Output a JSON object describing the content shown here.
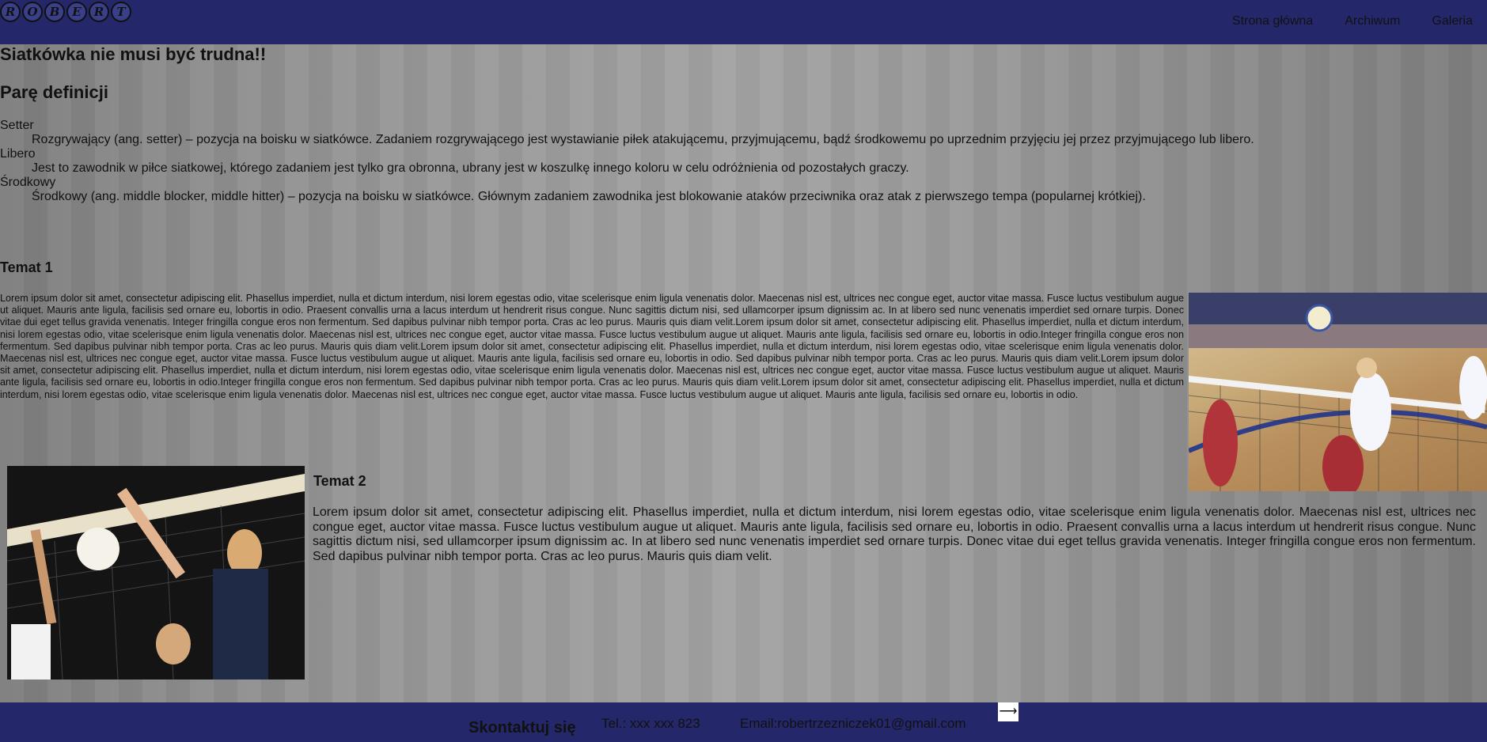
{
  "header": {
    "logo_letters": [
      "R",
      "O",
      "B",
      "E",
      "R",
      "T"
    ],
    "nav": [
      {
        "label": "Strona główna"
      },
      {
        "label": "Archiwum"
      },
      {
        "label": "Galeria"
      }
    ]
  },
  "main": {
    "title": "Siatkówka nie musi być trudna!!",
    "definitions_title": "Parę definicji",
    "definitions": [
      {
        "term": "Setter",
        "desc": "Rozgrywający (ang. setter) – pozycja na boisku w siatkówce. Zadaniem rozgrywającego jest wystawianie piłek atakującemu, przyjmującemu, bądź środkowemu po uprzednim przyjęciu jej przez przyjmującego lub libero."
      },
      {
        "term": "Libero",
        "desc": "Jest to zawodnik w piłce siatkowej, którego zadaniem jest tylko gra obronna, ubrany jest w koszulkę innego koloru w celu odróżnienia od pozostałych graczy."
      },
      {
        "term": "Środkowy",
        "desc": "Środkowy (ang. middle blocker, middle hitter) – pozycja na boisku w siatkówce. Głównym zadaniem zawodnika jest blokowanie ataków przeciwnika oraz atak z pierwszego tempa (popularnej krótkiej)."
      }
    ],
    "topic1": {
      "title": "Temat 1",
      "text": "Lorem ipsum dolor sit amet, consectetur adipiscing elit. Phasellus imperdiet, nulla et dictum interdum, nisi lorem egestas odio, vitae scelerisque enim ligula venenatis dolor. Maecenas nisl est, ultrices nec congue eget, auctor vitae massa. Fusce luctus vestibulum augue ut aliquet. Mauris ante ligula, facilisis sed ornare eu, lobortis in odio. Praesent convallis urna a lacus interdum ut hendrerit risus congue. Nunc sagittis dictum nisi, sed ullamcorper ipsum dignissim ac. In at libero sed nunc venenatis imperdiet sed ornare turpis. Donec vitae dui eget tellus gravida venenatis. Integer fringilla congue eros non fermentum. Sed dapibus pulvinar nibh tempor porta. Cras ac leo purus. Mauris quis diam velit.Lorem ipsum dolor sit amet, consectetur adipiscing elit. Phasellus imperdiet, nulla et dictum interdum, nisi lorem egestas odio, vitae scelerisque enim ligula venenatis dolor. Maecenas nisl est, ultrices nec congue eget, auctor vitae massa. Fusce luctus vestibulum augue ut aliquet. Mauris ante ligula, facilisis sed ornare eu, lobortis in odio.Integer fringilla congue eros non fermentum. Sed dapibus pulvinar nibh tempor porta. Cras ac leo purus. Mauris quis diam velit.Lorem ipsum dolor sit amet, consectetur adipiscing elit. Phasellus imperdiet, nulla et dictum interdum, nisi lorem egestas odio, vitae scelerisque enim ligula venenatis dolor. Maecenas nisl est, ultrices nec congue eget, auctor vitae massa. Fusce luctus vestibulum augue ut aliquet. Mauris ante ligula, facilisis sed ornare eu, lobortis in odio. Sed dapibus pulvinar nibh tempor porta. Cras ac leo purus. Mauris quis diam velit.Lorem ipsum dolor sit amet, consectetur adipiscing elit. Phasellus imperdiet, nulla et dictum interdum, nisi lorem egestas odio, vitae scelerisque enim ligula venenatis dolor. Maecenas nisl est, ultrices nec congue eget, auctor vitae massa. Fusce luctus vestibulum augue ut aliquet. Mauris ante ligula, facilisis sed ornare eu, lobortis in odio.Integer fringilla congue eros non fermentum. Sed dapibus pulvinar nibh tempor porta. Cras ac leo purus. Mauris quis diam velit.Lorem ipsum dolor sit amet, consectetur adipiscing elit. Phasellus imperdiet, nulla et dictum interdum, nisi lorem egestas odio, vitae scelerisque enim ligula venenatis dolor. Maecenas nisl est, ultrices nec congue eget, auctor vitae massa. Fusce luctus vestibulum augue ut aliquet. Mauris ante ligula, facilisis sed ornare eu, lobortis in odio."
    },
    "topic2": {
      "title": "Temat 2",
      "text": "Lorem ipsum dolor sit amet, consectetur adipiscing elit. Phasellus imperdiet, nulla et dictum interdum, nisi lorem egestas odio, vitae scelerisque enim ligula venenatis dolor. Maecenas nisl est, ultrices nec congue eget, auctor vitae massa. Fusce luctus vestibulum augue ut aliquet. Mauris ante ligula, facilisis sed ornare eu, lobortis in odio. Praesent convallis urna a lacus interdum ut hendrerit risus congue. Nunc sagittis dictum nisi, sed ullamcorper ipsum dignissim ac. In at libero sed nunc venenatis imperdiet sed ornare turpis. Donec vitae dui eget tellus gravida venenatis. Integer fringilla congue eros non fermentum. Sed dapibus pulvinar nibh tempor porta. Cras ac leo purus. Mauris quis diam velit."
    }
  },
  "footer": {
    "contact_title": "Skontaktuj się",
    "tel": "Tel.: xxx xxx 823",
    "email": "Email:robertrzezniczek01@gmail.com",
    "send_symbol": "⟶"
  },
  "colors": {
    "header_bg": "#24286b",
    "footer_bg": "#24286b",
    "page_bg": "#9e9e9e"
  }
}
